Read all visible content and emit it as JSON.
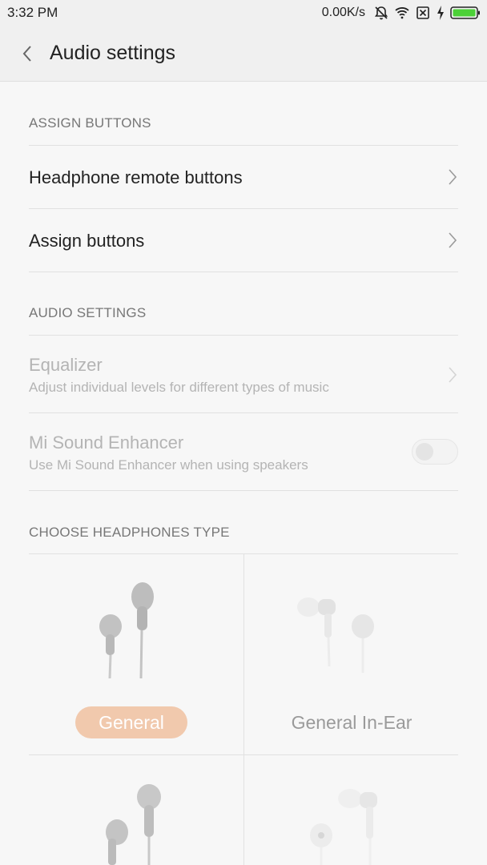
{
  "status_bar": {
    "time": "3:32 PM",
    "speed": "0.00K/s",
    "icons": [
      "muted-bell-icon",
      "wifi-icon",
      "no-sim-icon",
      "charging-icon",
      "battery-icon"
    ]
  },
  "header": {
    "back_icon": "back-arrow-icon",
    "title": "Audio settings"
  },
  "sections": {
    "assign": {
      "header": "ASSIGN BUTTONS",
      "items": [
        {
          "title": "Headphone remote buttons"
        },
        {
          "title": "Assign buttons"
        }
      ]
    },
    "audio": {
      "header": "AUDIO SETTINGS",
      "equalizer": {
        "title": "Equalizer",
        "subtitle": "Adjust individual levels for different types of music",
        "enabled": false
      },
      "enhancer": {
        "title": "Mi Sound Enhancer",
        "subtitle": "Use Mi Sound Enhancer when using speakers",
        "enabled": false,
        "toggle_on": false
      }
    },
    "headphones": {
      "header": "CHOOSE HEADPHONES TYPE",
      "types": [
        {
          "label": "General",
          "selected": true
        },
        {
          "label": "General In-Ear",
          "selected": false
        },
        {
          "label": "",
          "selected": false
        },
        {
          "label": "",
          "selected": false
        }
      ]
    }
  },
  "colors": {
    "selected_pill": "#f1c9ad",
    "disabled_text": "#b4b4b4",
    "section_header": "#777777"
  }
}
